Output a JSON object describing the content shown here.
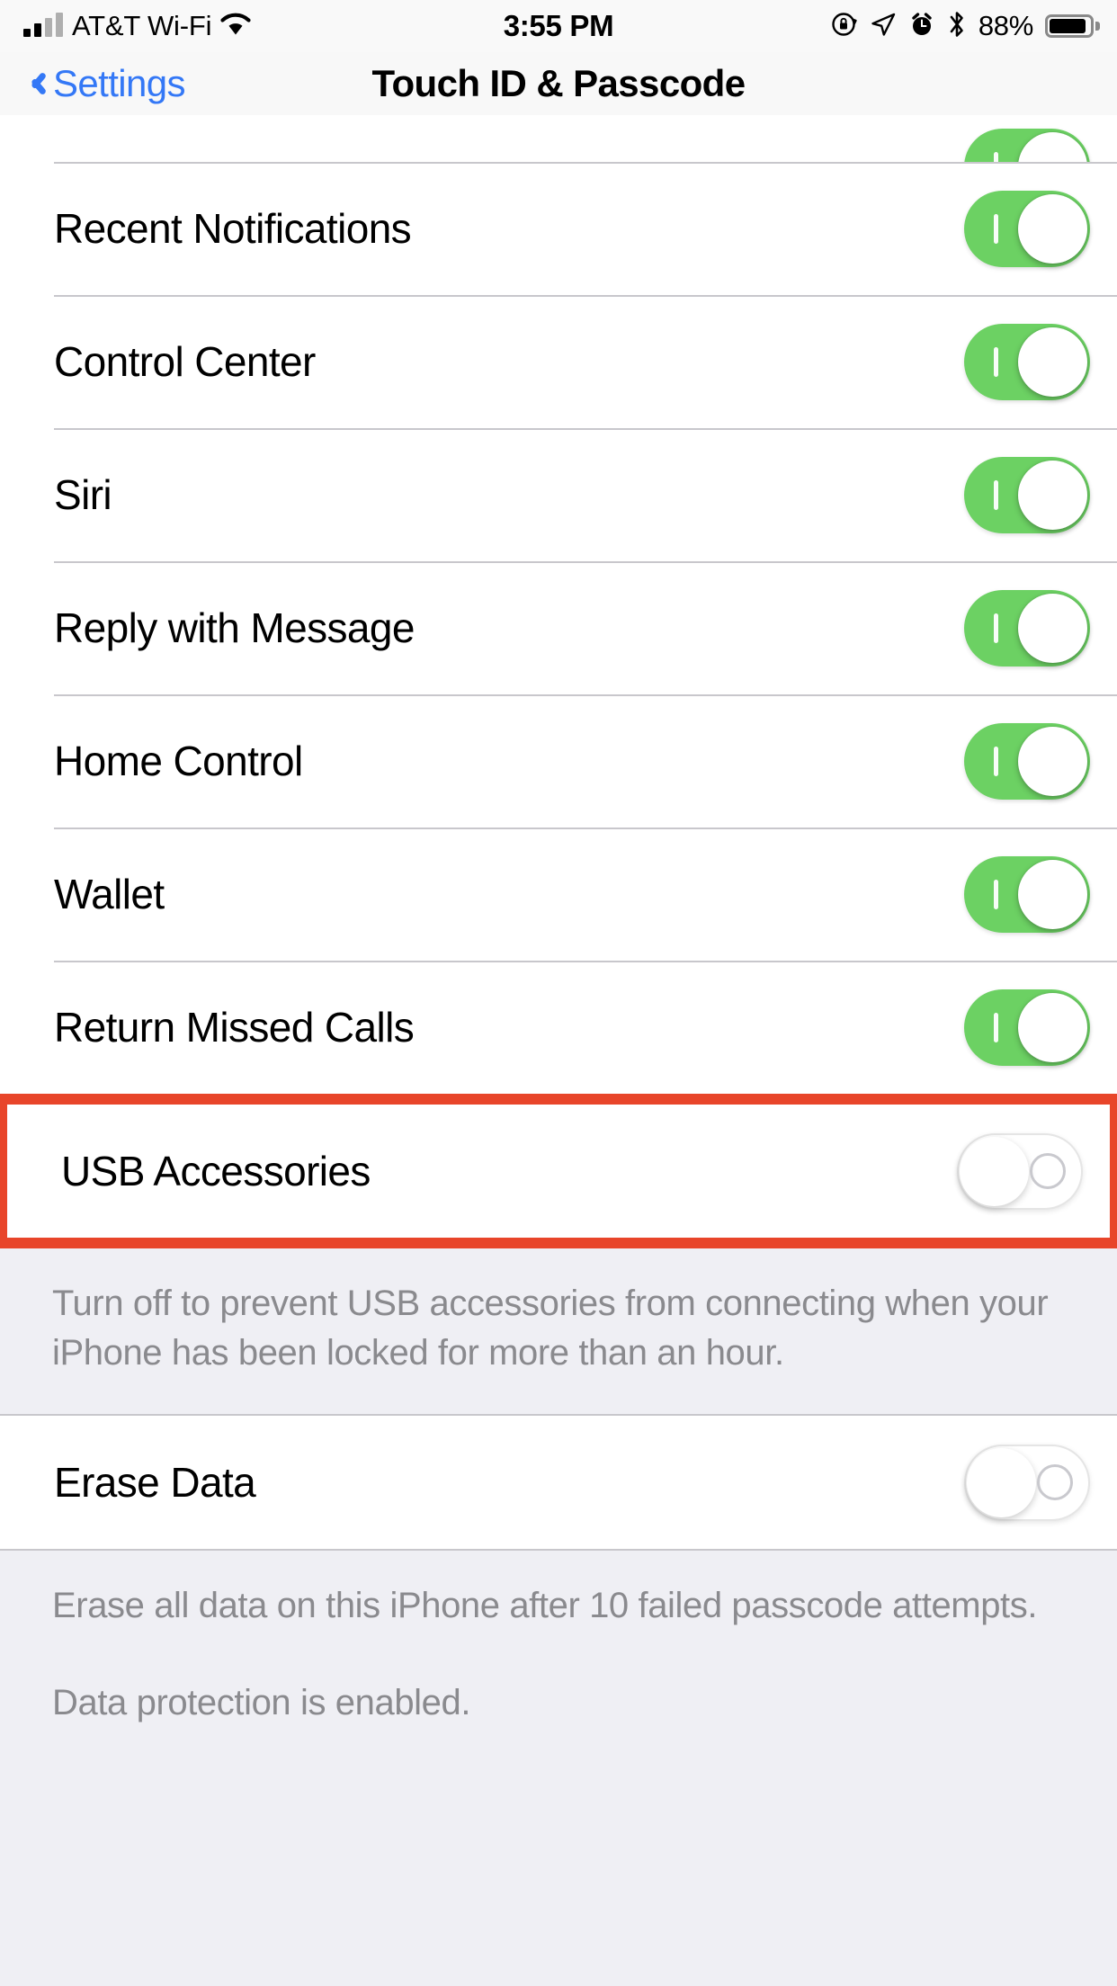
{
  "status_bar": {
    "carrier": "AT&T Wi-Fi",
    "time": "3:55 PM",
    "battery_percent": "88%",
    "icons": [
      "signal-bars-icon",
      "wifi-icon",
      "rotation-lock-icon",
      "location-arrow-icon",
      "alarm-clock-icon",
      "bluetooth-icon",
      "battery-icon"
    ]
  },
  "nav_bar": {
    "back_label": "Settings",
    "title": "Touch ID & Passcode"
  },
  "colors": {
    "accent_blue": "#3478F6",
    "switch_on_green": "#6CD163",
    "highlight_red": "#E8452A",
    "group_background": "#FFFFFF",
    "page_background": "#EFEFF4",
    "separator": "#C8C7CC",
    "footer_text": "#8A8A8E"
  },
  "sections": [
    {
      "id": "allow-access-when-locked",
      "clipped_first_row": {
        "label": "",
        "switch_state": "on"
      },
      "rows": [
        {
          "label": "Recent Notifications",
          "switch_state": "on",
          "highlighted": false
        },
        {
          "label": "Control Center",
          "switch_state": "on",
          "highlighted": false
        },
        {
          "label": "Siri",
          "switch_state": "on",
          "highlighted": false
        },
        {
          "label": "Reply with Message",
          "switch_state": "on",
          "highlighted": false
        },
        {
          "label": "Home Control",
          "switch_state": "on",
          "highlighted": false
        },
        {
          "label": "Wallet",
          "switch_state": "on",
          "highlighted": false
        },
        {
          "label": "Return Missed Calls",
          "switch_state": "on",
          "highlighted": false
        },
        {
          "label": "USB Accessories",
          "switch_state": "off",
          "highlighted": true
        }
      ],
      "footer": "Turn off to prevent USB accessories from connecting when your iPhone has been locked for more than an hour."
    },
    {
      "id": "erase-data",
      "rows": [
        {
          "label": "Erase Data",
          "switch_state": "off",
          "highlighted": false
        }
      ],
      "footer_lines": [
        "Erase all data on this iPhone after 10 failed passcode attempts.",
        "Data protection is enabled."
      ]
    }
  ]
}
